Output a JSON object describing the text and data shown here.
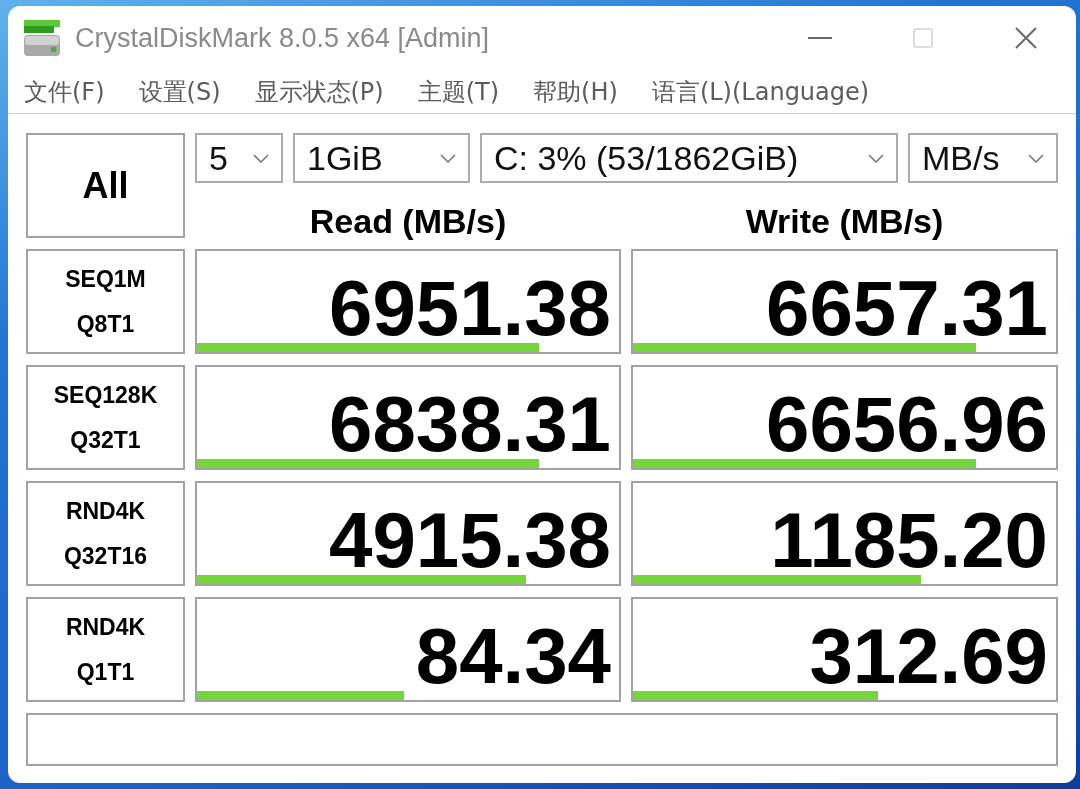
{
  "window": {
    "title": "CrystalDiskMark 8.0.5 x64 [Admin]",
    "controls": [
      {
        "kind": "minimize",
        "disabled": false
      },
      {
        "kind": "maximize",
        "disabled": true
      },
      {
        "kind": "close",
        "disabled": false
      }
    ]
  },
  "menu": [
    "文件(F)",
    "设置(S)",
    "显示状态(P)",
    "主题(T)",
    "帮助(H)",
    "语言(L)(Language)"
  ],
  "all_button": "All",
  "selectors": [
    "5",
    "1GiB",
    "C: 3% (53/1862GiB)",
    "MB/s"
  ],
  "columns": [
    "Read (MB/s)",
    "Write (MB/s)"
  ],
  "tests": [
    {
      "name": "SEQ1M",
      "params": "Q8T1",
      "read": {
        "value": "6951.38",
        "level": 0.81
      },
      "write": {
        "value": "6657.31",
        "level": 0.81
      }
    },
    {
      "name": "SEQ128K",
      "params": "Q32T1",
      "read": {
        "value": "6838.31",
        "level": 0.81
      },
      "write": {
        "value": "6656.96",
        "level": 0.81
      }
    },
    {
      "name": "RND4K",
      "params": "Q32T16",
      "read": {
        "value": "4915.38",
        "level": 0.78
      },
      "write": {
        "value": "1185.20",
        "level": 0.68
      }
    },
    {
      "name": "RND4K",
      "params": "Q1T1",
      "read": {
        "value": "84.34",
        "level": 0.49
      },
      "write": {
        "value": "312.69",
        "level": 0.58
      }
    }
  ]
}
